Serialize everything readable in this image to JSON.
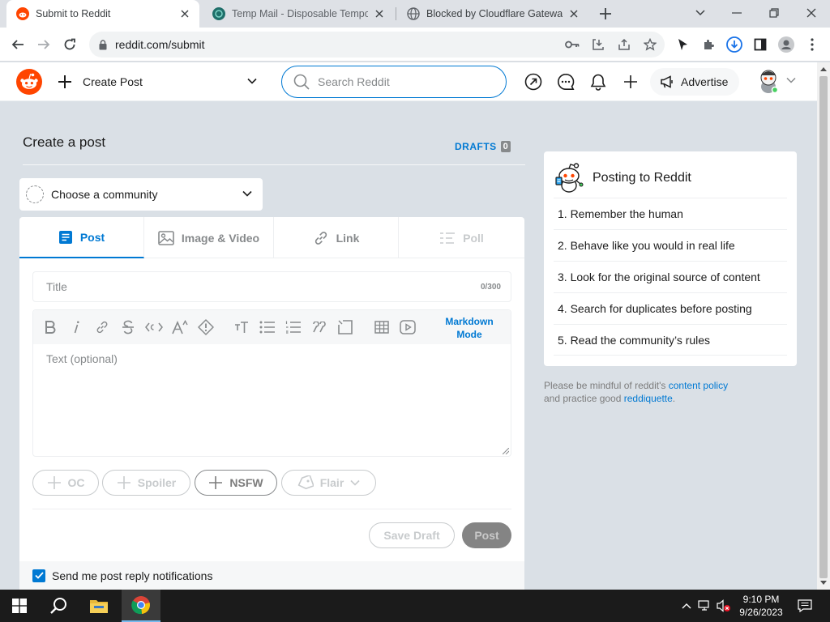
{
  "browser": {
    "tabs": [
      {
        "title": "Submit to Reddit",
        "active": true
      },
      {
        "title": "Temp Mail - Disposable Tempora",
        "active": false
      },
      {
        "title": "Blocked by Cloudflare Gateway",
        "active": false
      }
    ],
    "url": "reddit.com/submit"
  },
  "header": {
    "create_post_label": "Create Post",
    "search_placeholder": "Search Reddit",
    "advertise_label": "Advertise"
  },
  "main": {
    "page_title": "Create a post",
    "drafts_label": "DRAFTS",
    "drafts_count": "0",
    "community_placeholder": "Choose a community",
    "tabs": [
      {
        "label": "Post"
      },
      {
        "label": "Image & Video"
      },
      {
        "label": "Link"
      },
      {
        "label": "Poll"
      }
    ],
    "title_placeholder": "Title",
    "title_counter": "0/300",
    "markdown_line1": "Markdown",
    "markdown_line2": "Mode",
    "text_placeholder": "Text (optional)",
    "tags": {
      "oc": "OC",
      "spoiler": "Spoiler",
      "nsfw": "NSFW",
      "flair": "Flair"
    },
    "save_draft_label": "Save Draft",
    "post_label": "Post",
    "notify_label": "Send me post reply notifications"
  },
  "sidebar": {
    "title": "Posting to Reddit",
    "rules": [
      "1. Remember the human",
      "2. Behave like you would in real life",
      "3. Look for the original source of content",
      "4. Search for duplicates before posting",
      "5. Read the community’s rules"
    ],
    "policy_prefix": "Please be mindful of reddit's ",
    "policy_link": "content policy",
    "policy_middle": "and practice good ",
    "policy_link2": "reddiquette",
    "policy_suffix": "."
  },
  "taskbar": {
    "time": "9:10 PM",
    "date": "9/26/2023"
  },
  "colors": {
    "reddit_orange": "#ff4500",
    "accent_blue": "#0079d3",
    "page_bg": "#dae0e6"
  }
}
